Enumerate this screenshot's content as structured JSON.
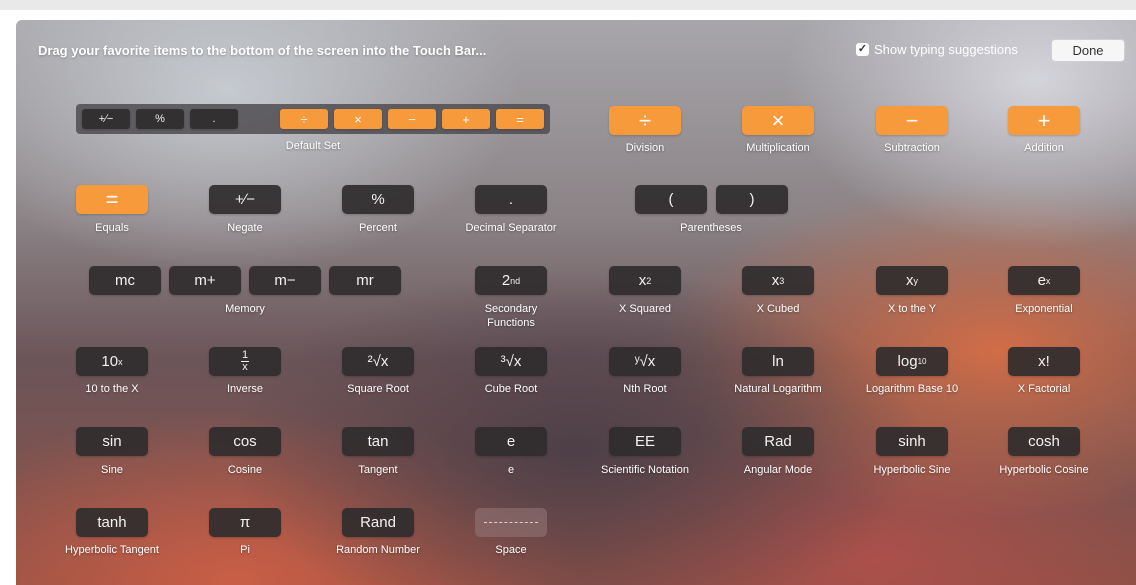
{
  "header": {
    "instruction": "Drag your favorite items to the bottom of the screen into the Touch Bar...",
    "show_suggestions_label": "Show typing suggestions",
    "show_suggestions_checked": true,
    "done_label": "Done"
  },
  "default_set": {
    "label": "Default Set",
    "keys": [
      "+∕−",
      "%",
      ".",
      "÷",
      "×",
      "−",
      "+",
      "="
    ]
  },
  "keys": {
    "division": {
      "symbol": "÷",
      "label": "Division"
    },
    "multiplication": {
      "symbol": "×",
      "label": "Multiplication"
    },
    "subtraction": {
      "symbol": "−",
      "label": "Subtraction"
    },
    "addition": {
      "symbol": "+",
      "label": "Addition"
    },
    "equals": {
      "symbol": "=",
      "label": "Equals"
    },
    "negate": {
      "symbol": "+∕−",
      "label": "Negate"
    },
    "percent": {
      "symbol": "%",
      "label": "Percent"
    },
    "decimal": {
      "symbol": ".",
      "label": "Decimal Separator"
    },
    "parentheses": {
      "open": "(",
      "close": ")",
      "label": "Parentheses"
    },
    "memory": {
      "mc": "mc",
      "mplus": "m+",
      "mminus": "m−",
      "mr": "mr",
      "label": "Memory"
    },
    "secondary": {
      "base": "2",
      "sup": "nd",
      "label_line1": "Secondary",
      "label_line2": "Functions"
    },
    "x_squared": {
      "base": "x",
      "sup": "2",
      "label": "X Squared"
    },
    "x_cubed": {
      "base": "x",
      "sup": "3",
      "label": "X Cubed"
    },
    "x_to_y": {
      "base": "x",
      "sup": "y",
      "label": "X to the Y"
    },
    "exponential": {
      "base": "e",
      "sup": "x",
      "label": "Exponential"
    },
    "ten_to_x": {
      "base": "10",
      "sup": "x",
      "label": "10 to the X"
    },
    "inverse": {
      "num": "1",
      "den": "x",
      "label": "Inverse"
    },
    "square_root": {
      "symbol": "²√x",
      "label": "Square Root"
    },
    "cube_root": {
      "symbol": "³√x",
      "label": "Cube Root"
    },
    "nth_root": {
      "symbol": "ʸ√x",
      "label": "Nth Root"
    },
    "ln": {
      "symbol": "ln",
      "label": "Natural Logarithm"
    },
    "log10": {
      "base": "log",
      "sub": "10",
      "label": "Logarithm Base 10"
    },
    "factorial": {
      "symbol": "x!",
      "label": "X Factorial"
    },
    "sin": {
      "symbol": "sin",
      "label": "Sine"
    },
    "cos": {
      "symbol": "cos",
      "label": "Cosine"
    },
    "tan": {
      "symbol": "tan",
      "label": "Tangent"
    },
    "e": {
      "symbol": "e",
      "label": "e"
    },
    "ee": {
      "symbol": "EE",
      "label": "Scientific Notation"
    },
    "rad": {
      "symbol": "Rad",
      "label": "Angular Mode"
    },
    "sinh": {
      "symbol": "sinh",
      "label": "Hyperbolic Sine"
    },
    "cosh": {
      "symbol": "cosh",
      "label": "Hyperbolic Cosine"
    },
    "tanh": {
      "symbol": "tanh",
      "label": "Hyperbolic Tangent"
    },
    "pi": {
      "symbol": "π",
      "label": "Pi"
    },
    "rand": {
      "symbol": "Rand",
      "label": "Random Number"
    },
    "space": {
      "label": "Space"
    }
  },
  "colors": {
    "accent_orange": "#f79a3b",
    "key_dark": "#302c2e"
  }
}
